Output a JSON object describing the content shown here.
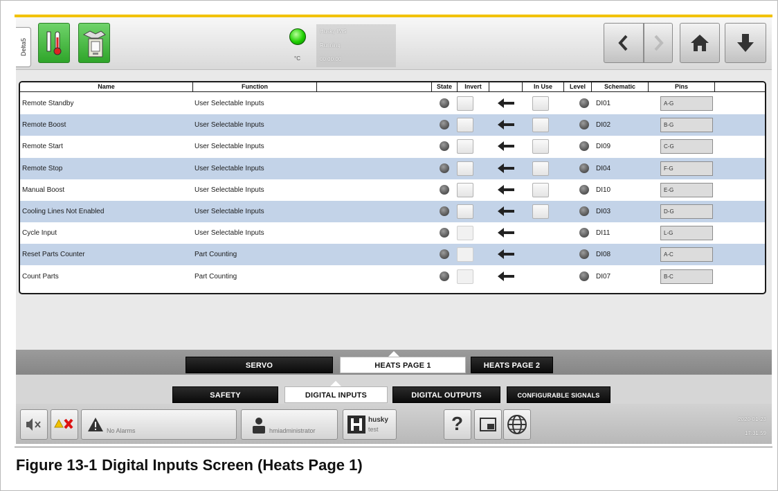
{
  "side_tab": "Delta5",
  "status": {
    "unit": "°C",
    "line1": "Husky IMS",
    "line2": "Running",
    "line3": "00:00:00",
    "led_color": "#1fd000"
  },
  "nav": {
    "back_icon": "chevron-left-icon",
    "forward_icon": "chevron-right-icon",
    "home_icon": "home-icon",
    "download_icon": "down-arrow-icon"
  },
  "table": {
    "headers": [
      "Name",
      "Function",
      "",
      "State",
      "Invert",
      "",
      "In Use",
      "Level",
      "Schematic",
      "Pins",
      ""
    ],
    "rows": [
      {
        "name": "Remote Standby",
        "function": "User Selectable Inputs",
        "schematic": "DI01",
        "pins": "A-G",
        "in_use": true
      },
      {
        "name": "Remote Boost",
        "function": "User Selectable Inputs",
        "schematic": "DI02",
        "pins": "B-G",
        "in_use": true
      },
      {
        "name": "Remote Start",
        "function": "User Selectable Inputs",
        "schematic": "DI09",
        "pins": "C-G",
        "in_use": true
      },
      {
        "name": "Remote Stop",
        "function": "User Selectable Inputs",
        "schematic": "DI04",
        "pins": "F-G",
        "in_use": true
      },
      {
        "name": "Manual Boost",
        "function": "User Selectable Inputs",
        "schematic": "DI10",
        "pins": "E-G",
        "in_use": true
      },
      {
        "name": "Cooling Lines Not Enabled",
        "function": "User Selectable Inputs",
        "schematic": "DI03",
        "pins": "D-G",
        "in_use": true
      },
      {
        "name": "Cycle Input",
        "function": "User Selectable Inputs",
        "schematic": "DI11",
        "pins": "L-G",
        "in_use": false
      },
      {
        "name": "Reset Parts Counter",
        "function": "Part Counting",
        "schematic": "DI08",
        "pins": "A-C",
        "in_use": false
      },
      {
        "name": "Count Parts",
        "function": "Part Counting",
        "schematic": "DI07",
        "pins": "B-C",
        "in_use": false
      }
    ]
  },
  "page_tabs": {
    "servo": "SERVO",
    "heats1": "HEATS PAGE 1",
    "heats2": "HEATS PAGE 2"
  },
  "category_tabs": {
    "safety": "SAFETY",
    "digital_inputs": "DIGITAL INPUTS",
    "digital_outputs": "DIGITAL OUTPUTS",
    "configurable": "CONFIGURABLE SIGNALS"
  },
  "bottom": {
    "alarms": "No Alarms",
    "user": "hmiadministrator",
    "machine_name": "husky",
    "machine_sub": "test",
    "help": "?",
    "date": "2020-01-23",
    "time": "17:31:59"
  },
  "caption": {
    "number": "Figure 13-1",
    "title": "Digital Inputs Screen (Heats Page 1)"
  }
}
